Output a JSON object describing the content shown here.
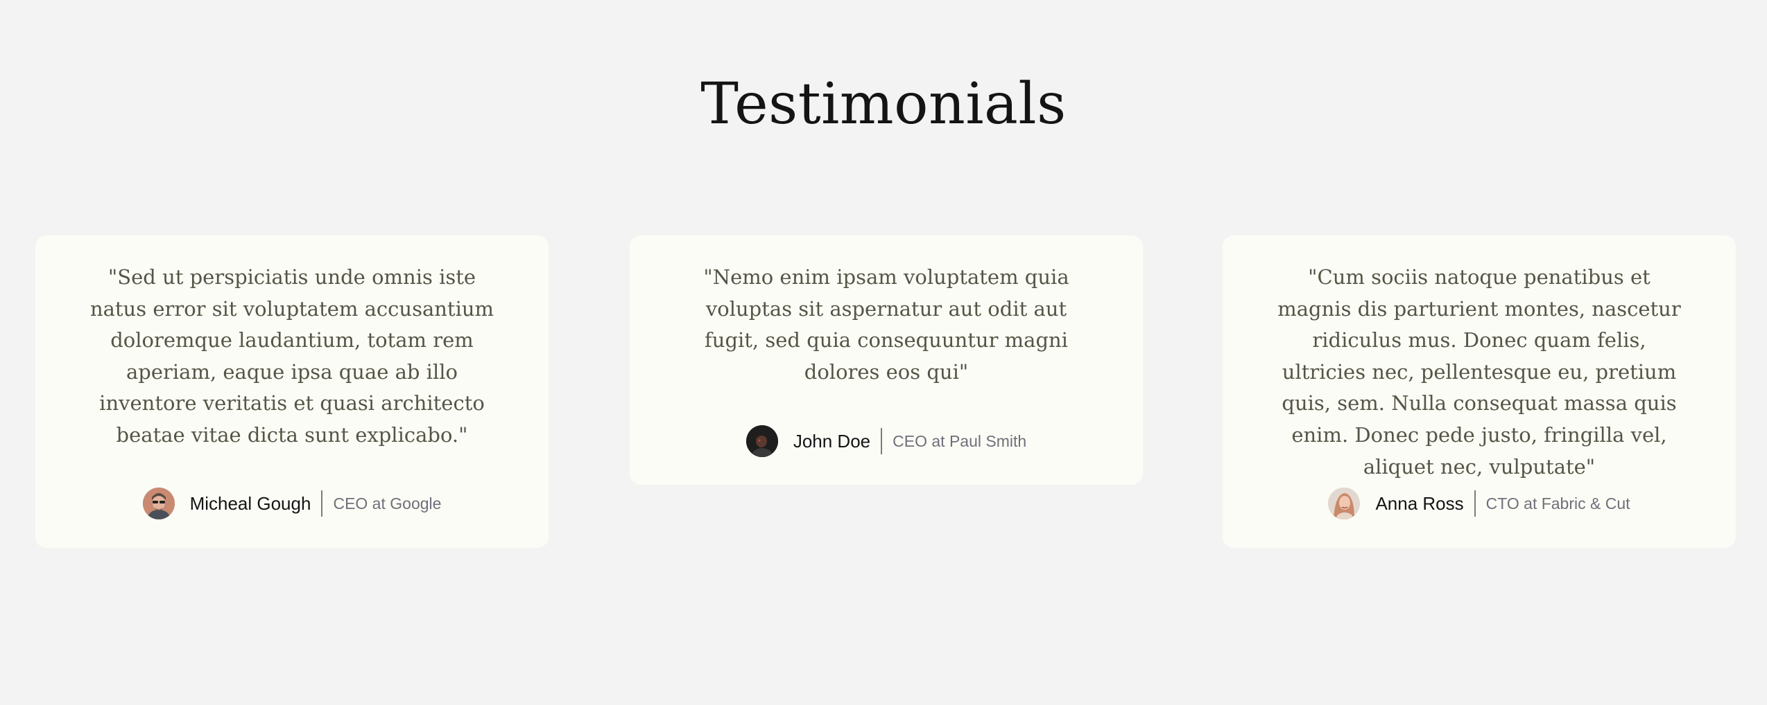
{
  "header": {
    "title": "Testimonials"
  },
  "testimonials": [
    {
      "quote": "\"Sed ut perspiciatis unde omnis iste natus error sit voluptatem accusantium doloremque laudantium, totam rem aperiam, eaque ipsa quae ab illo inventore veritatis et quasi architecto beatae vitae dicta sunt explicabo.\"",
      "name": "Micheal Gough",
      "role": "CEO at Google",
      "avatar_icon": "person-avatar-icon"
    },
    {
      "quote": "\"Nemo enim ipsam voluptatem quia voluptas sit aspernatur aut odit aut fugit, sed quia consequuntur magni dolores eos qui\"",
      "name": "John Doe",
      "role": "CEO at Paul Smith",
      "avatar_icon": "person-avatar-icon"
    },
    {
      "quote": "\"Cum sociis natoque penatibus et magnis dis parturient montes, nascetur ridiculus mus. Donec quam felis, ultricies nec, pellentesque eu, pretium quis, sem. Nulla consequat massa quis enim. Donec pede justo, fringilla vel, aliquet nec, vulputate\"",
      "name": "Anna Ross",
      "role": "CTO at Fabric & Cut",
      "avatar_icon": "person-avatar-icon"
    }
  ],
  "colors": {
    "background": "#f3f3f3",
    "card": "#fcfcf6",
    "quote_text": "#555547",
    "title_text": "#141414",
    "role_text": "#6f6f7a"
  }
}
